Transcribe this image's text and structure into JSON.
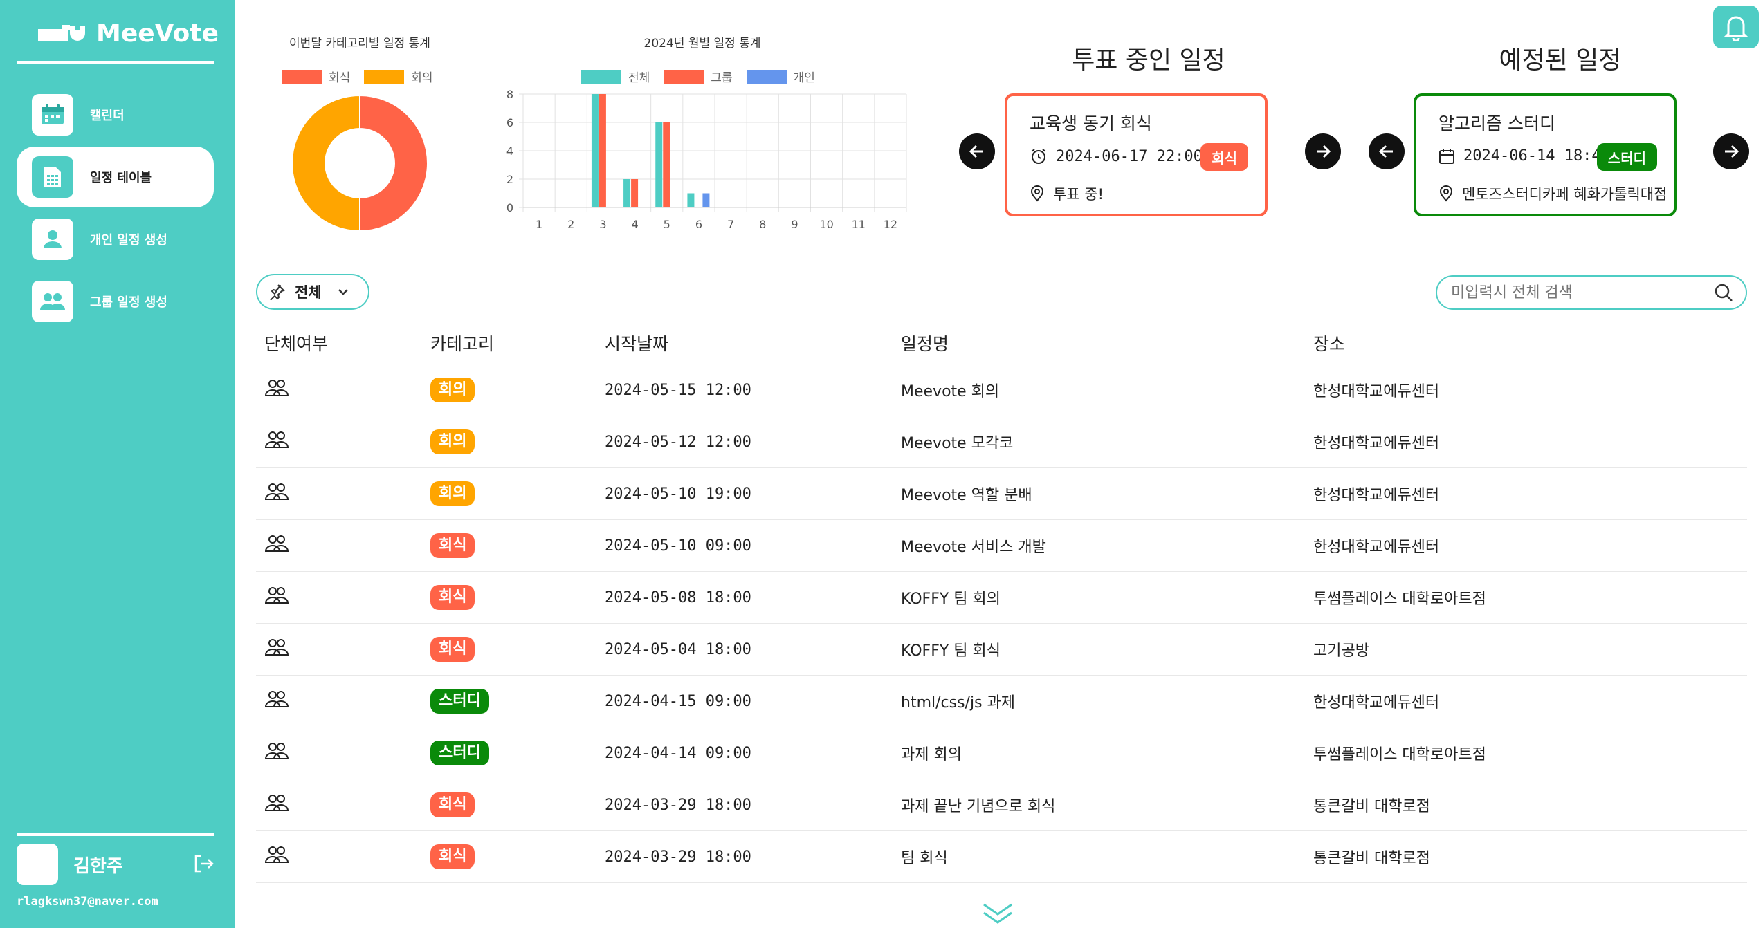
{
  "app": {
    "name": "MeeVote"
  },
  "sidebar": {
    "items": [
      {
        "label": "캘린더",
        "icon": "calendar-icon",
        "active": false
      },
      {
        "label": "일정 테이블",
        "icon": "table-icon",
        "active": true
      },
      {
        "label": "개인 일정 생성",
        "icon": "person-icon",
        "active": false
      },
      {
        "label": "그룹 일정 생성",
        "icon": "group-icon",
        "active": false
      }
    ],
    "user": {
      "name": "김한주",
      "email": "rlagkswn37@naver.com"
    }
  },
  "donut": {
    "title": "이번달 카테고리별 일정 통계",
    "legend": [
      "회식",
      "회의"
    ]
  },
  "bar_chart": {
    "title": "2024년 월별 일정 통계",
    "legend": [
      "전체",
      "그룹",
      "개인"
    ]
  },
  "chart_data": [
    {
      "type": "pie",
      "title": "이번달 카테고리별 일정 통계",
      "labels": [
        "회식",
        "회의"
      ],
      "values": [
        1,
        1
      ],
      "colors": [
        "#ff6347",
        "#ffa500"
      ],
      "legend": "top"
    },
    {
      "type": "bar",
      "title": "2024년 월별 일정 통계",
      "categories": [
        "1",
        "2",
        "3",
        "4",
        "5",
        "6",
        "7",
        "8",
        "9",
        "10",
        "11",
        "12"
      ],
      "series": [
        {
          "name": "전체",
          "color": "#4ecdc4",
          "values": [
            0,
            0,
            8,
            2,
            6,
            1,
            0,
            0,
            0,
            0,
            0,
            0
          ]
        },
        {
          "name": "그룹",
          "color": "#ff6347",
          "values": [
            0,
            0,
            8,
            2,
            6,
            0,
            0,
            0,
            0,
            0,
            0,
            0
          ]
        },
        {
          "name": "개인",
          "color": "#6495ed",
          "values": [
            0,
            0,
            0,
            0,
            0,
            1,
            0,
            0,
            0,
            0,
            0,
            0
          ]
        }
      ],
      "ylim": [
        0,
        8
      ],
      "yticks": [
        0,
        2,
        4,
        6,
        8
      ],
      "grid": true,
      "legend": "top"
    }
  ],
  "voting": {
    "title": "투표 중인 일정",
    "card": {
      "title": "교육생 동기 회식",
      "datetime": "2024-06-17 22:00",
      "location": "투표 중!",
      "badge": "회식",
      "badge_color": "#ff6347",
      "border_color": "#ff6347"
    }
  },
  "scheduled": {
    "title": "예정된 일정",
    "card": {
      "title": "알고리즘 스터디",
      "datetime": "2024-06-14 18:46",
      "location": "멘토즈스터디카페 혜화가톨릭대점",
      "badge": "스터디",
      "badge_color": "#0a8a0a",
      "border_color": "#0a8a0a"
    }
  },
  "filter": {
    "label": "전체"
  },
  "search": {
    "placeholder": "미입력시 전체 검색"
  },
  "table": {
    "headers": [
      "단체여부",
      "카테고리",
      "시작날짜",
      "일정명",
      "장소"
    ],
    "rows": [
      {
        "category": "회의",
        "color": "#ffa500",
        "date": "2024-05-15 12:00",
        "name": "Meevote 회의",
        "place": "한성대학교에듀센터"
      },
      {
        "category": "회의",
        "color": "#ffa500",
        "date": "2024-05-12 12:00",
        "name": "Meevote 모각코",
        "place": "한성대학교에듀센터"
      },
      {
        "category": "회의",
        "color": "#ffa500",
        "date": "2024-05-10 19:00",
        "name": "Meevote 역할 분배",
        "place": "한성대학교에듀센터"
      },
      {
        "category": "회식",
        "color": "#ff6347",
        "date": "2024-05-10 09:00",
        "name": "Meevote 서비스 개발",
        "place": "한성대학교에듀센터"
      },
      {
        "category": "회식",
        "color": "#ff6347",
        "date": "2024-05-08 18:00",
        "name": "KOFFY 팀 회의",
        "place": "투썸플레이스 대학로아트점"
      },
      {
        "category": "회식",
        "color": "#ff6347",
        "date": "2024-05-04 18:00",
        "name": "KOFFY 팀 회식",
        "place": "고기공방"
      },
      {
        "category": "스터디",
        "color": "#0a8a0a",
        "date": "2024-04-15 09:00",
        "name": "html/css/js 과제",
        "place": "한성대학교에듀센터"
      },
      {
        "category": "스터디",
        "color": "#0a8a0a",
        "date": "2024-04-14 09:00",
        "name": "과제 회의",
        "place": "투썸플레이스 대학로아트점"
      },
      {
        "category": "회식",
        "color": "#ff6347",
        "date": "2024-03-29 18:00",
        "name": "과제 끝난 기념으로 회식",
        "place": "통큰갈비 대학로점"
      },
      {
        "category": "회식",
        "color": "#ff6347",
        "date": "2024-03-29 18:00",
        "name": "팀 회식",
        "place": "통큰갈비 대학로점"
      }
    ]
  }
}
